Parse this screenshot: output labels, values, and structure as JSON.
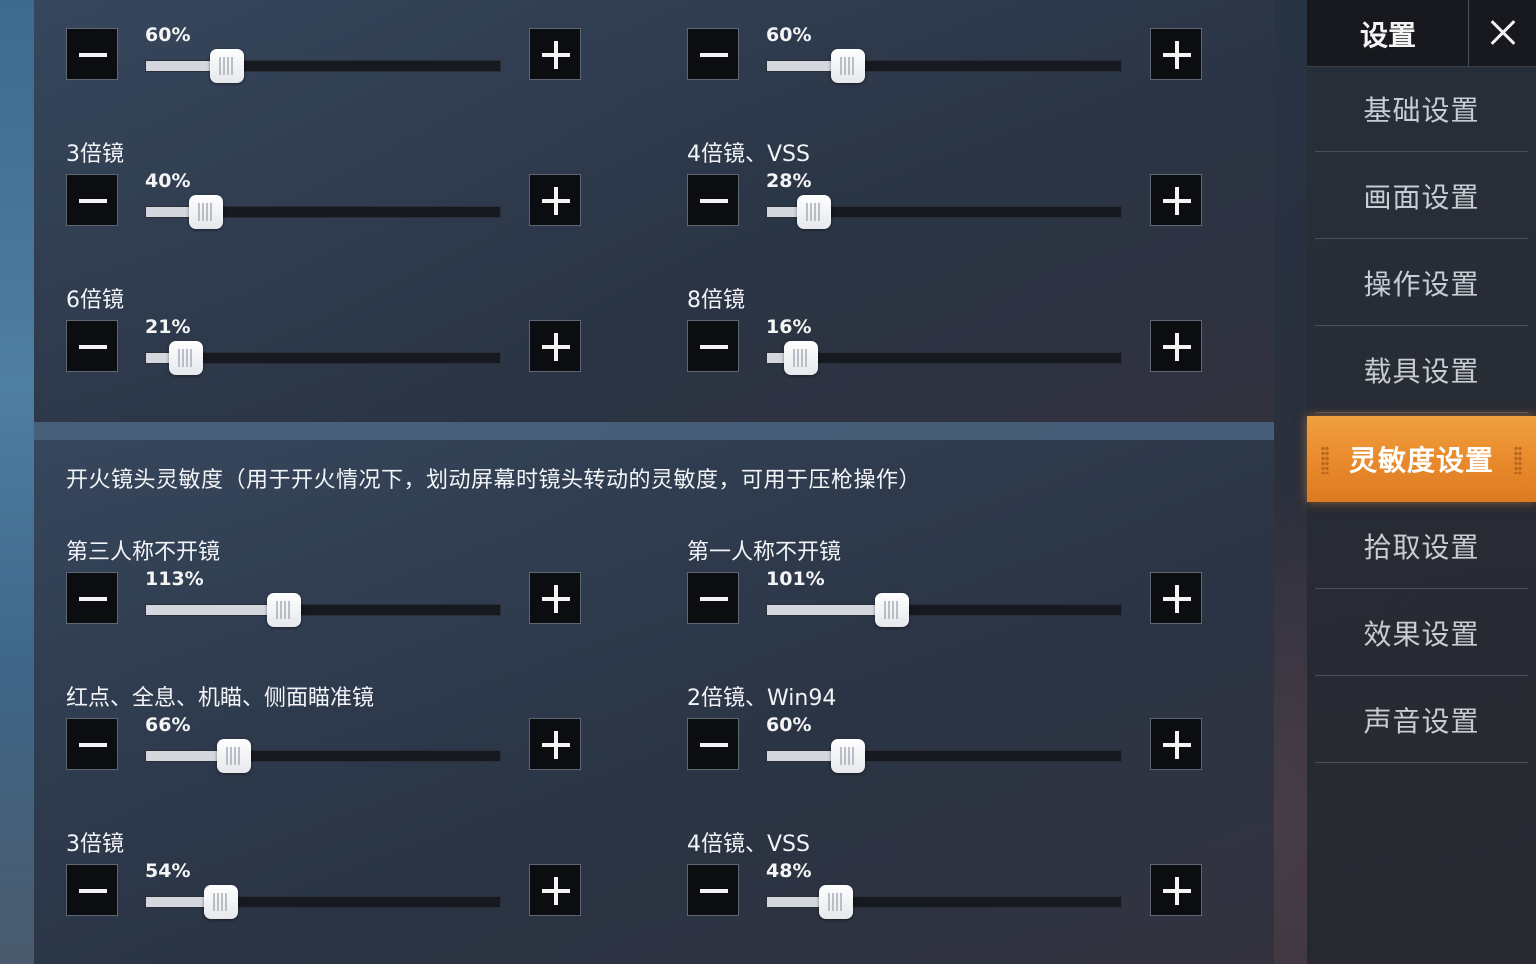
{
  "sidebar": {
    "title": "设置",
    "items": [
      {
        "label": "基础设置",
        "active": false
      },
      {
        "label": "画面设置",
        "active": false
      },
      {
        "label": "操作设置",
        "active": false
      },
      {
        "label": "载具设置",
        "active": false
      },
      {
        "label": "灵敏度设置",
        "active": true
      },
      {
        "label": "拾取设置",
        "active": false
      },
      {
        "label": "效果设置",
        "active": false
      },
      {
        "label": "声音设置",
        "active": false
      }
    ]
  },
  "top_section": {
    "sliders": [
      {
        "label": "",
        "value": "60%",
        "percent": 60
      },
      {
        "label": "",
        "value": "60%",
        "percent": 60
      },
      {
        "label": "3倍镜",
        "value": "40%",
        "percent": 40
      },
      {
        "label": "4倍镜、VSS",
        "value": "28%",
        "percent": 28
      },
      {
        "label": "6倍镜",
        "value": "21%",
        "percent": 21
      },
      {
        "label": "8倍镜",
        "value": "16%",
        "percent": 16
      }
    ]
  },
  "fire_section": {
    "title": "开火镜头灵敏度（用于开火情况下，划动屏幕时镜头转动的灵敏度，可用于压枪操作）",
    "sliders": [
      {
        "label": "第三人称不开镜",
        "value": "113%",
        "percent": 113
      },
      {
        "label": "第一人称不开镜",
        "value": "101%",
        "percent": 101
      },
      {
        "label": "红点、全息、机瞄、侧面瞄准镜",
        "value": "66%",
        "percent": 66
      },
      {
        "label": "2倍镜、Win94",
        "value": "60%",
        "percent": 60
      },
      {
        "label": "3倍镜",
        "value": "54%",
        "percent": 54
      },
      {
        "label": "4倍镜、VSS",
        "value": "48%",
        "percent": 48
      }
    ]
  },
  "slider_max_percent": 300,
  "colors": {
    "accent": "#e98b2c",
    "track": "#16191f",
    "fill": "#d4d8de"
  }
}
